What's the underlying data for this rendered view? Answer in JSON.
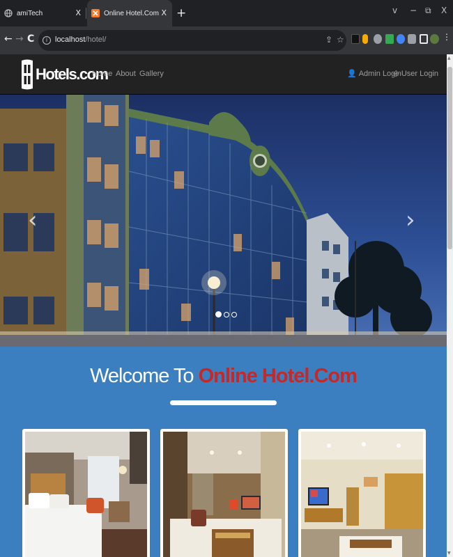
{
  "browser": {
    "tabs": [
      {
        "title": "amiTech",
        "icon": "globe-icon",
        "active": false,
        "close": "X"
      },
      {
        "title": "Online Hotel.Com",
        "icon": "xampp-icon",
        "active": true,
        "close": "X"
      }
    ],
    "new_tab": "+",
    "window_controls": {
      "dropdown": "v",
      "minimize": "−",
      "restore": "⧉",
      "close": "X"
    },
    "url": {
      "host": "localhost",
      "path": "/hotel/"
    },
    "nav": {
      "back": "←",
      "forward": "→",
      "reload": "C"
    }
  },
  "site": {
    "logo_text": "Hotels.com",
    "nav_links": [
      "Home",
      "About",
      "Gallery"
    ],
    "admin_login": "Admin Login",
    "user_login": "User Login"
  },
  "carousel": {
    "prev": "‹",
    "next": "›",
    "slide_count": 3,
    "active_slide": 0
  },
  "welcome": {
    "prefix": "Welcome To ",
    "brand": "Online Hotel.Com"
  },
  "colors": {
    "page_bg": "#3b7fc0",
    "brand_red": "#c62828",
    "navbar": "#222222",
    "chrome_dark": "#202124",
    "chrome_toolbar": "#35363a"
  }
}
